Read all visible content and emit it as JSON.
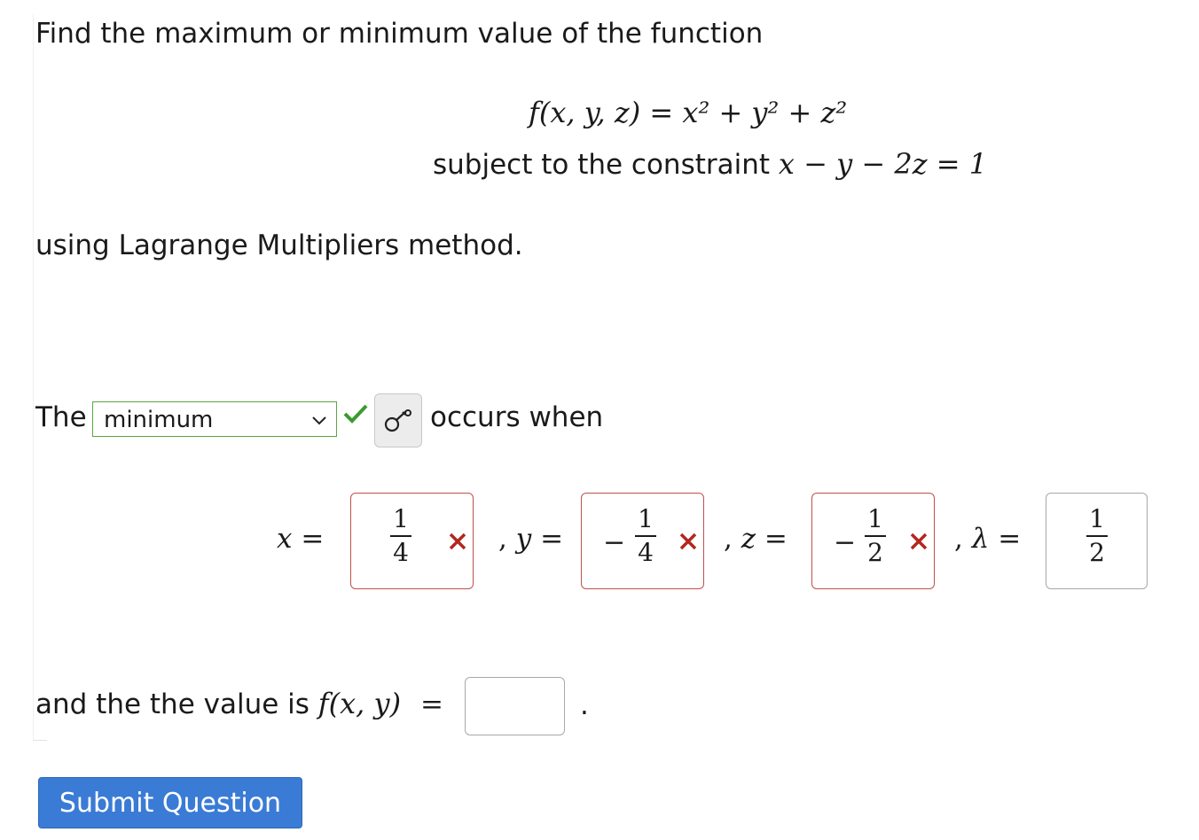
{
  "question": {
    "intro": "Find the maximum or minimum value of the function",
    "function_lhs": "f(x, y, z)",
    "function_rhs": "x² + y² + z²",
    "constraint_prefix": "subject to the constraint",
    "constraint_math": "x − y − 2z = 1",
    "method": "using Lagrange Multipliers method."
  },
  "answer_row": {
    "prefix": "The",
    "select_value": "minimum",
    "select_status": "correct",
    "suffix": "occurs when"
  },
  "fields": [
    {
      "var": "x",
      "separator": "",
      "sign": "",
      "numerator": "1",
      "denominator": "4",
      "status": "incorrect"
    },
    {
      "var": "y",
      "separator": ",",
      "sign": "−",
      "numerator": "1",
      "denominator": "4",
      "status": "incorrect"
    },
    {
      "var": "z",
      "separator": ",",
      "sign": "−",
      "numerator": "1",
      "denominator": "2",
      "status": "incorrect"
    },
    {
      "var": "λ",
      "separator": ",",
      "sign": "",
      "numerator": "1",
      "denominator": "2",
      "status": "unmarked"
    }
  ],
  "value_row": {
    "prefix": "and the the value is",
    "func": "f(x, y)",
    "equals": "=",
    "answer": "",
    "trailing": "."
  },
  "submit_label": "Submit Question",
  "colors": {
    "correct": "#3a9a2f",
    "incorrect": "#b3261e",
    "button": "#3a7bd5"
  }
}
